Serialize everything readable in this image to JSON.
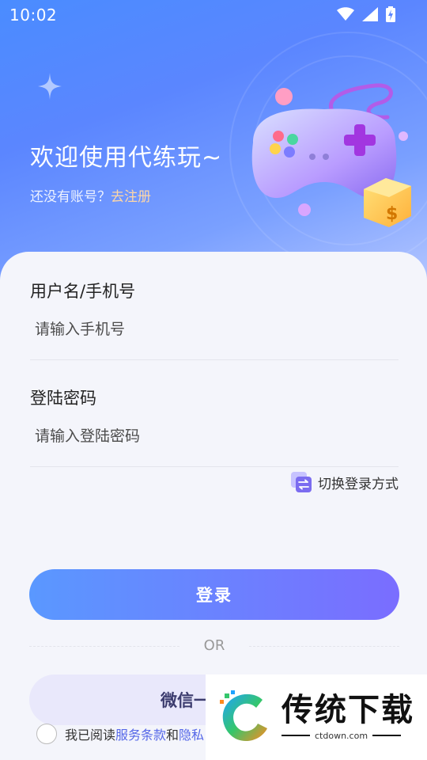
{
  "status_bar": {
    "time": "10:02"
  },
  "header": {
    "welcome": "欢迎使用代练玩~",
    "no_account_prefix": "还没有账号？",
    "register_link": "去注册"
  },
  "form": {
    "username_label": "用户名/手机号",
    "username_placeholder": "请输入手机号",
    "password_label": "登陆密码",
    "password_placeholder": "请输入登陆密码",
    "switch_method": "切换登录方式"
  },
  "actions": {
    "login": "登录",
    "or": "OR",
    "wechat": "微信一"
  },
  "agreement": {
    "prefix": "我已阅读",
    "terms": "服务条款",
    "and": "和",
    "privacy": "隐私"
  },
  "watermark": {
    "title": "传统下载",
    "url": "ctdown.com"
  },
  "colors": {
    "hero_gradient_start": "#4a8cff",
    "login_gradient_start": "#5a98ff",
    "login_gradient_end": "#7a6dff",
    "register_link": "#ffd7a6",
    "agreement_link": "#5668e8"
  }
}
